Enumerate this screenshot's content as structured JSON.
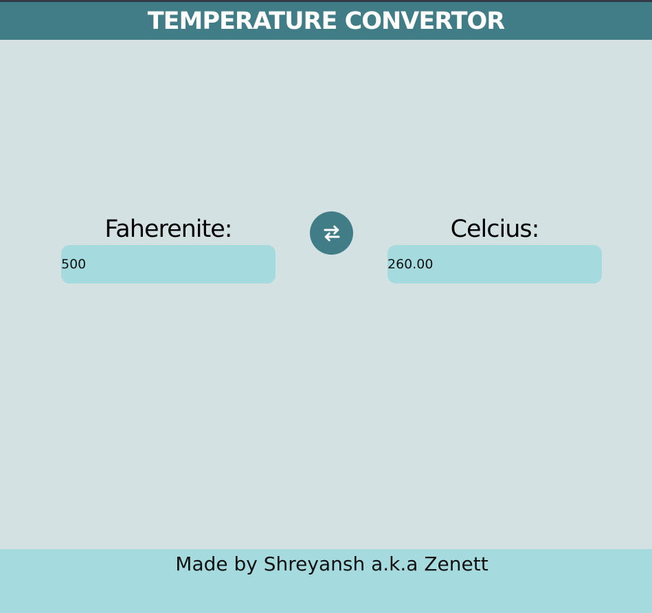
{
  "header": {
    "title": "TEMPERATURE CONVERTOR"
  },
  "fahrenheit": {
    "label": "Faherenite:",
    "value": "500"
  },
  "celsius": {
    "label": "Celcius:",
    "value": "260.00"
  },
  "swap": {
    "icon": "swap-arrows-icon"
  },
  "footer": {
    "text": "Made by Shreyansh a.k.a Zenett"
  },
  "colors": {
    "header_bg": "#417d86",
    "page_bg": "#d4e1e3",
    "input_bg": "#a5dade",
    "footer_bg": "#a5dade"
  }
}
